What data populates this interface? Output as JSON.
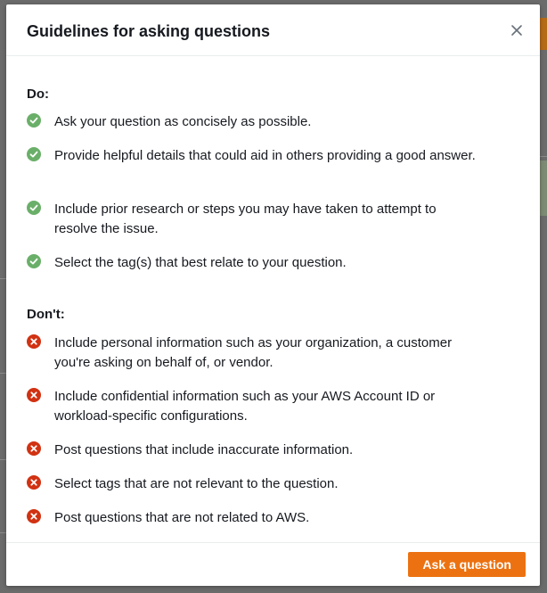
{
  "modal": {
    "title": "Guidelines for asking questions",
    "close_icon": "close-icon",
    "do_section": {
      "heading": "Do:",
      "items": [
        "Ask your question as concisely as possible.",
        "Provide helpful details that could aid in others providing a good answer.",
        "Include prior research or steps you may have taken to attempt to resolve the issue.",
        "Select the tag(s) that best relate to your question."
      ]
    },
    "dont_section": {
      "heading": "Don't:",
      "items": [
        "Include personal information such as your organization, a customer you're asking on behalf of, or vendor.",
        "Include confidential information such as your AWS Account ID or workload-specific configurations.",
        "Post questions that include inaccurate information.",
        "Select tags that are not relevant to the question.",
        "Post questions that are not related to AWS."
      ]
    },
    "primary_button": "Ask a question"
  },
  "colors": {
    "accent": "#ec7211",
    "success": "#6aaf69",
    "error": "#d13212",
    "overlay": "#6b6b6b"
  }
}
